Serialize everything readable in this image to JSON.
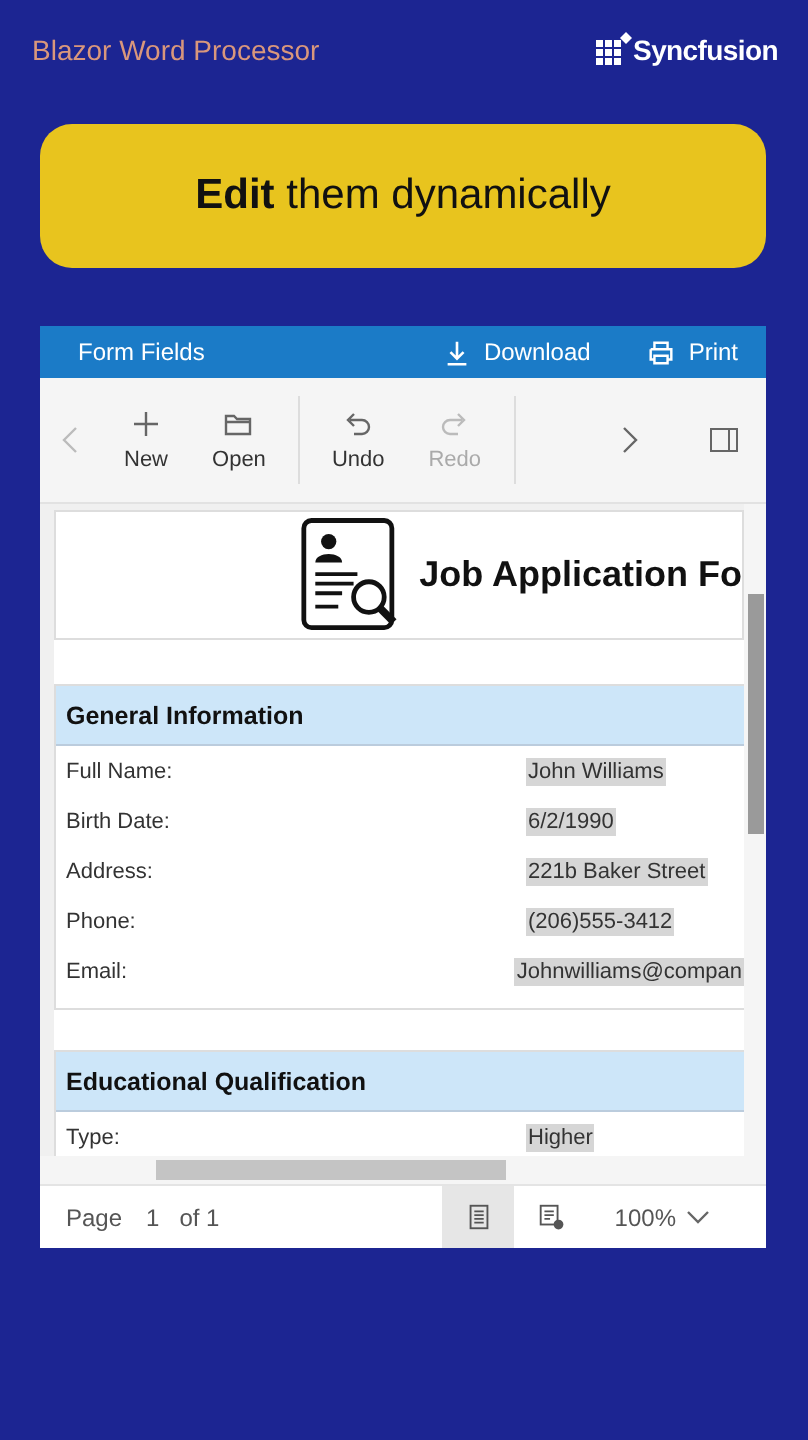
{
  "header": {
    "title": "Blazor Word Processor",
    "brand": "Syncfusion"
  },
  "banner": {
    "text": "**Edit** them dynamically"
  },
  "editor": {
    "title_bar": {
      "title": "Form Fields",
      "actions": [
        {
          "label": "Download",
          "kind": "download"
        },
        {
          "label": "Print",
          "kind": "print"
        }
      ]
    },
    "toolbar": {
      "groups": [
        [
          {
            "label": "New",
            "kind": "plus",
            "disabled": false
          },
          {
            "label": "Open",
            "kind": "folder",
            "disabled": false
          }
        ],
        [
          {
            "label": "Undo",
            "kind": "undo",
            "disabled": false
          },
          {
            "label": "Redo",
            "kind": "redo",
            "disabled": true
          }
        ]
      ]
    },
    "document": {
      "heading": "Job Application Fo",
      "sections": [
        {
          "title": "General Information",
          "rows": [
            {
              "label": "Full Name:",
              "value": "John Williams"
            },
            {
              "label": "Birth Date:",
              "value": "6/2/1990"
            },
            {
              "label": "Address:",
              "value": "221b Baker Street"
            },
            {
              "label": "Phone:",
              "value": "(206)555-3412"
            },
            {
              "label": "Email:",
              "value": "Johnwilliams@compan"
            }
          ]
        },
        {
          "title": "Educational Qualification",
          "rows": [
            {
              "label": "Type:",
              "value": "Higher"
            }
          ]
        }
      ]
    },
    "status_bar": {
      "page_label": "Page",
      "page": "1",
      "of_label": "of 1",
      "layouts": [
        {
          "kind": "print-layout",
          "selected": true
        },
        {
          "kind": "web-layout",
          "selected": false
        }
      ],
      "zoom": "100%"
    }
  }
}
